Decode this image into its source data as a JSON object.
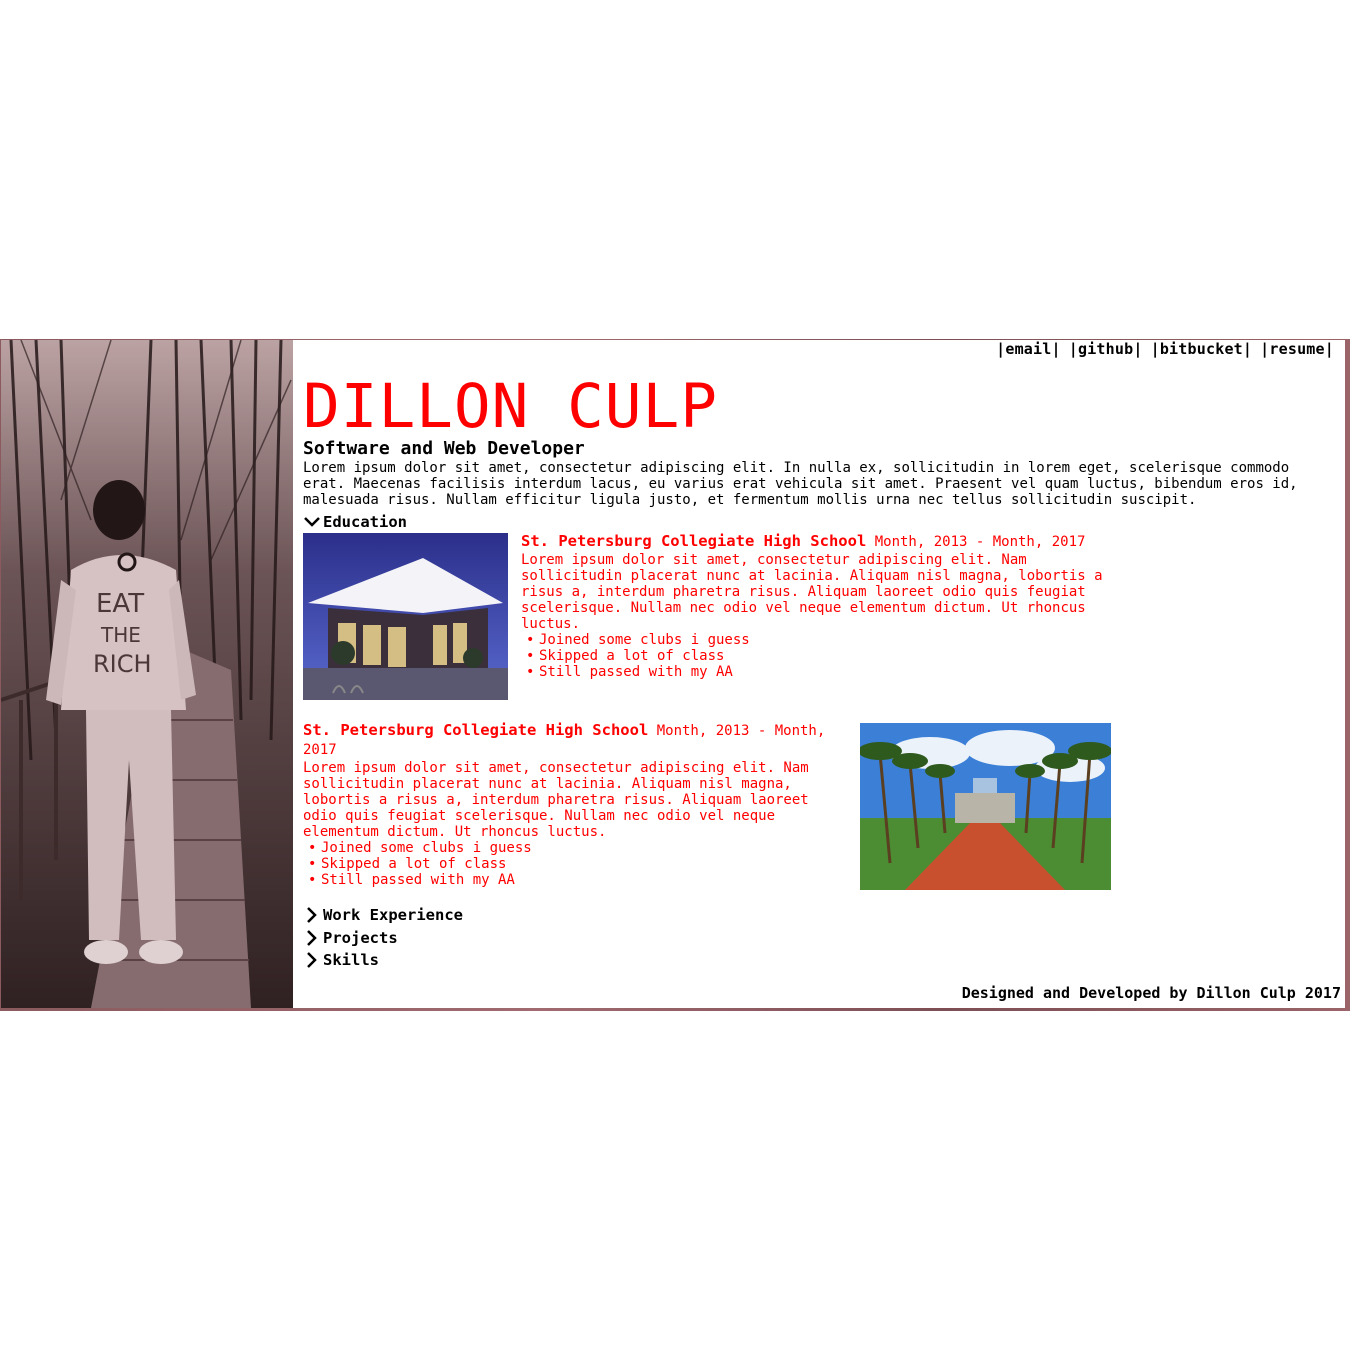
{
  "links": [
    "|email|",
    "|github|",
    "|bitbucket|",
    "|resume|"
  ],
  "header": {
    "name": "DILLON CULP",
    "role": "Software and Web Developer",
    "intro": "Lorem ipsum dolor sit amet, consectetur adipiscing elit. In nulla ex, sollicitudin in lorem eget, scelerisque commodo erat. Maecenas facilisis interdum lacus, eu varius erat vehicula sit amet. Praesent vel quam luctus, bibendum eros id, malesuada risus. Nullam efficitur ligula justo, et fermentum mollis urna nec tellus sollicitudin suscipit."
  },
  "sections": {
    "education": "Education",
    "work": "Work Experience",
    "projects": "Projects",
    "skills": "Skills"
  },
  "education": [
    {
      "school": "St. Petersburg Collegiate High School",
      "dates": "Month, 2013 - Month, 2017",
      "description": "Lorem ipsum dolor sit amet, consectetur adipiscing elit. Nam sollicitudin placerat nunc at lacinia. Aliquam nisl magna, lobortis a risus a, interdum pharetra risus. Aliquam laoreet odio quis feugiat scelerisque. Nullam nec odio vel neque elementum dictum. Ut rhoncus luctus.",
      "bullets": [
        "Joined some clubs i guess",
        "Skipped a lot of class",
        "Still passed with my AA"
      ]
    },
    {
      "school": "St. Petersburg Collegiate High School",
      "dates": "Month, 2013 - Month, 2017",
      "description": "Lorem ipsum dolor sit amet, consectetur adipiscing elit. Nam sollicitudin placerat nunc at lacinia. Aliquam nisl magna, lobortis a risus a, interdum pharetra risus. Aliquam laoreet odio quis feugiat scelerisque. Nullam nec odio vel neque elementum dictum. Ut rhoncus luctus.",
      "bullets": [
        "Joined some clubs i guess",
        "Skipped a lot of class",
        "Still passed with my AA"
      ]
    }
  ],
  "photo_text": [
    "EAT",
    "THE",
    "RICH"
  ],
  "footer": "Designed and Developed by Dillon Culp 2017",
  "colors": {
    "accent": "#ff0000",
    "text": "#000000",
    "frame": "#8a5a5e"
  }
}
